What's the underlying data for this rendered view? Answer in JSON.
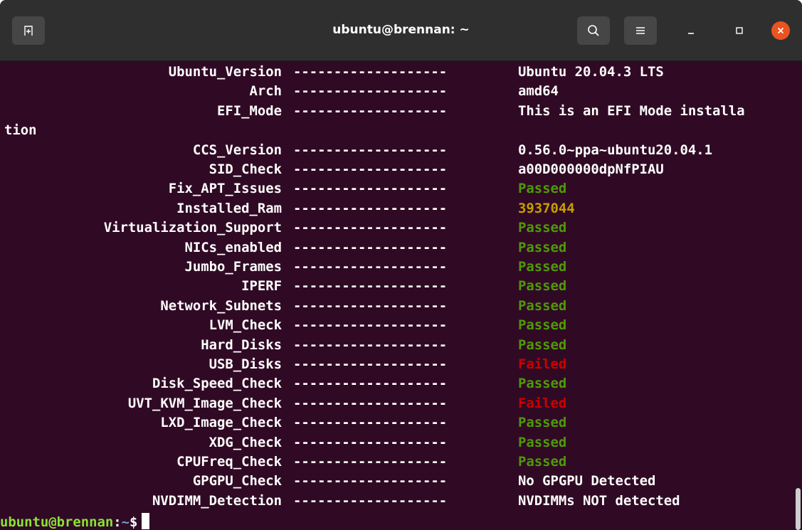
{
  "window": {
    "title": "ubuntu@brennan: ~"
  },
  "titlebar": {
    "icons": {
      "new_tab": "new-tab-icon",
      "search": "search-icon",
      "menu": "hamburger-menu-icon",
      "minimize": "minimize-icon",
      "maximize": "maximize-icon",
      "close": "close-icon"
    },
    "close_color": "#e95420"
  },
  "terminal": {
    "background": "#300a24",
    "separator": "-------------------",
    "rows": [
      {
        "label": "Ubuntu_Version",
        "value": "Ubuntu 20.04.3 LTS",
        "status": "plain"
      },
      {
        "label": "Arch",
        "value": "amd64",
        "status": "plain"
      },
      {
        "label": "EFI_Mode",
        "value": "This is an EFI Mode installa",
        "status": "plain"
      },
      {
        "label": "CCS_Version",
        "value": "0.56.0~ppa~ubuntu20.04.1",
        "status": "plain"
      },
      {
        "label": "SID_Check",
        "value": "a00D000000dpNfPIAU",
        "status": "plain"
      },
      {
        "label": "Fix_APT_Issues",
        "value": "Passed",
        "status": "passed"
      },
      {
        "label": "Installed_Ram",
        "value": "3937044",
        "status": "warning"
      },
      {
        "label": "Virtualization_Support",
        "value": "Passed",
        "status": "passed"
      },
      {
        "label": "NICs_enabled",
        "value": "Passed",
        "status": "passed"
      },
      {
        "label": "Jumbo_Frames",
        "value": "Passed",
        "status": "passed"
      },
      {
        "label": "IPERF",
        "value": "Passed",
        "status": "passed"
      },
      {
        "label": "Network_Subnets",
        "value": "Passed",
        "status": "passed"
      },
      {
        "label": "LVM_Check",
        "value": "Passed",
        "status": "passed"
      },
      {
        "label": "Hard_Disks",
        "value": "Passed",
        "status": "passed"
      },
      {
        "label": "USB_Disks",
        "value": "Failed",
        "status": "failed"
      },
      {
        "label": "Disk_Speed_Check",
        "value": "Passed",
        "status": "passed"
      },
      {
        "label": "UVT_KVM_Image_Check",
        "value": "Failed",
        "status": "failed"
      },
      {
        "label": "LXD_Image_Check",
        "value": "Passed",
        "status": "passed"
      },
      {
        "label": "XDG_Check",
        "value": "Passed",
        "status": "passed"
      },
      {
        "label": "CPUFreq_Check",
        "value": "Passed",
        "status": "passed"
      },
      {
        "label": "GPGPU_Check",
        "value": "No GPGPU Detected",
        "status": "plain"
      },
      {
        "label": "NVDIMM_Detection",
        "value": "NVDIMMs NOT detected",
        "status": "plain"
      }
    ],
    "wrapped_continuation": "tion",
    "prompt": {
      "user_host": "ubuntu@brennan",
      "colon": ":",
      "path": "~",
      "symbol": "$"
    },
    "colors": {
      "passed": "#4e9a06",
      "failed": "#cc0000",
      "warning": "#c4a000",
      "plain": "#ffffff",
      "prompt_user": "#8ae234",
      "prompt_path": "#729fcf"
    }
  }
}
